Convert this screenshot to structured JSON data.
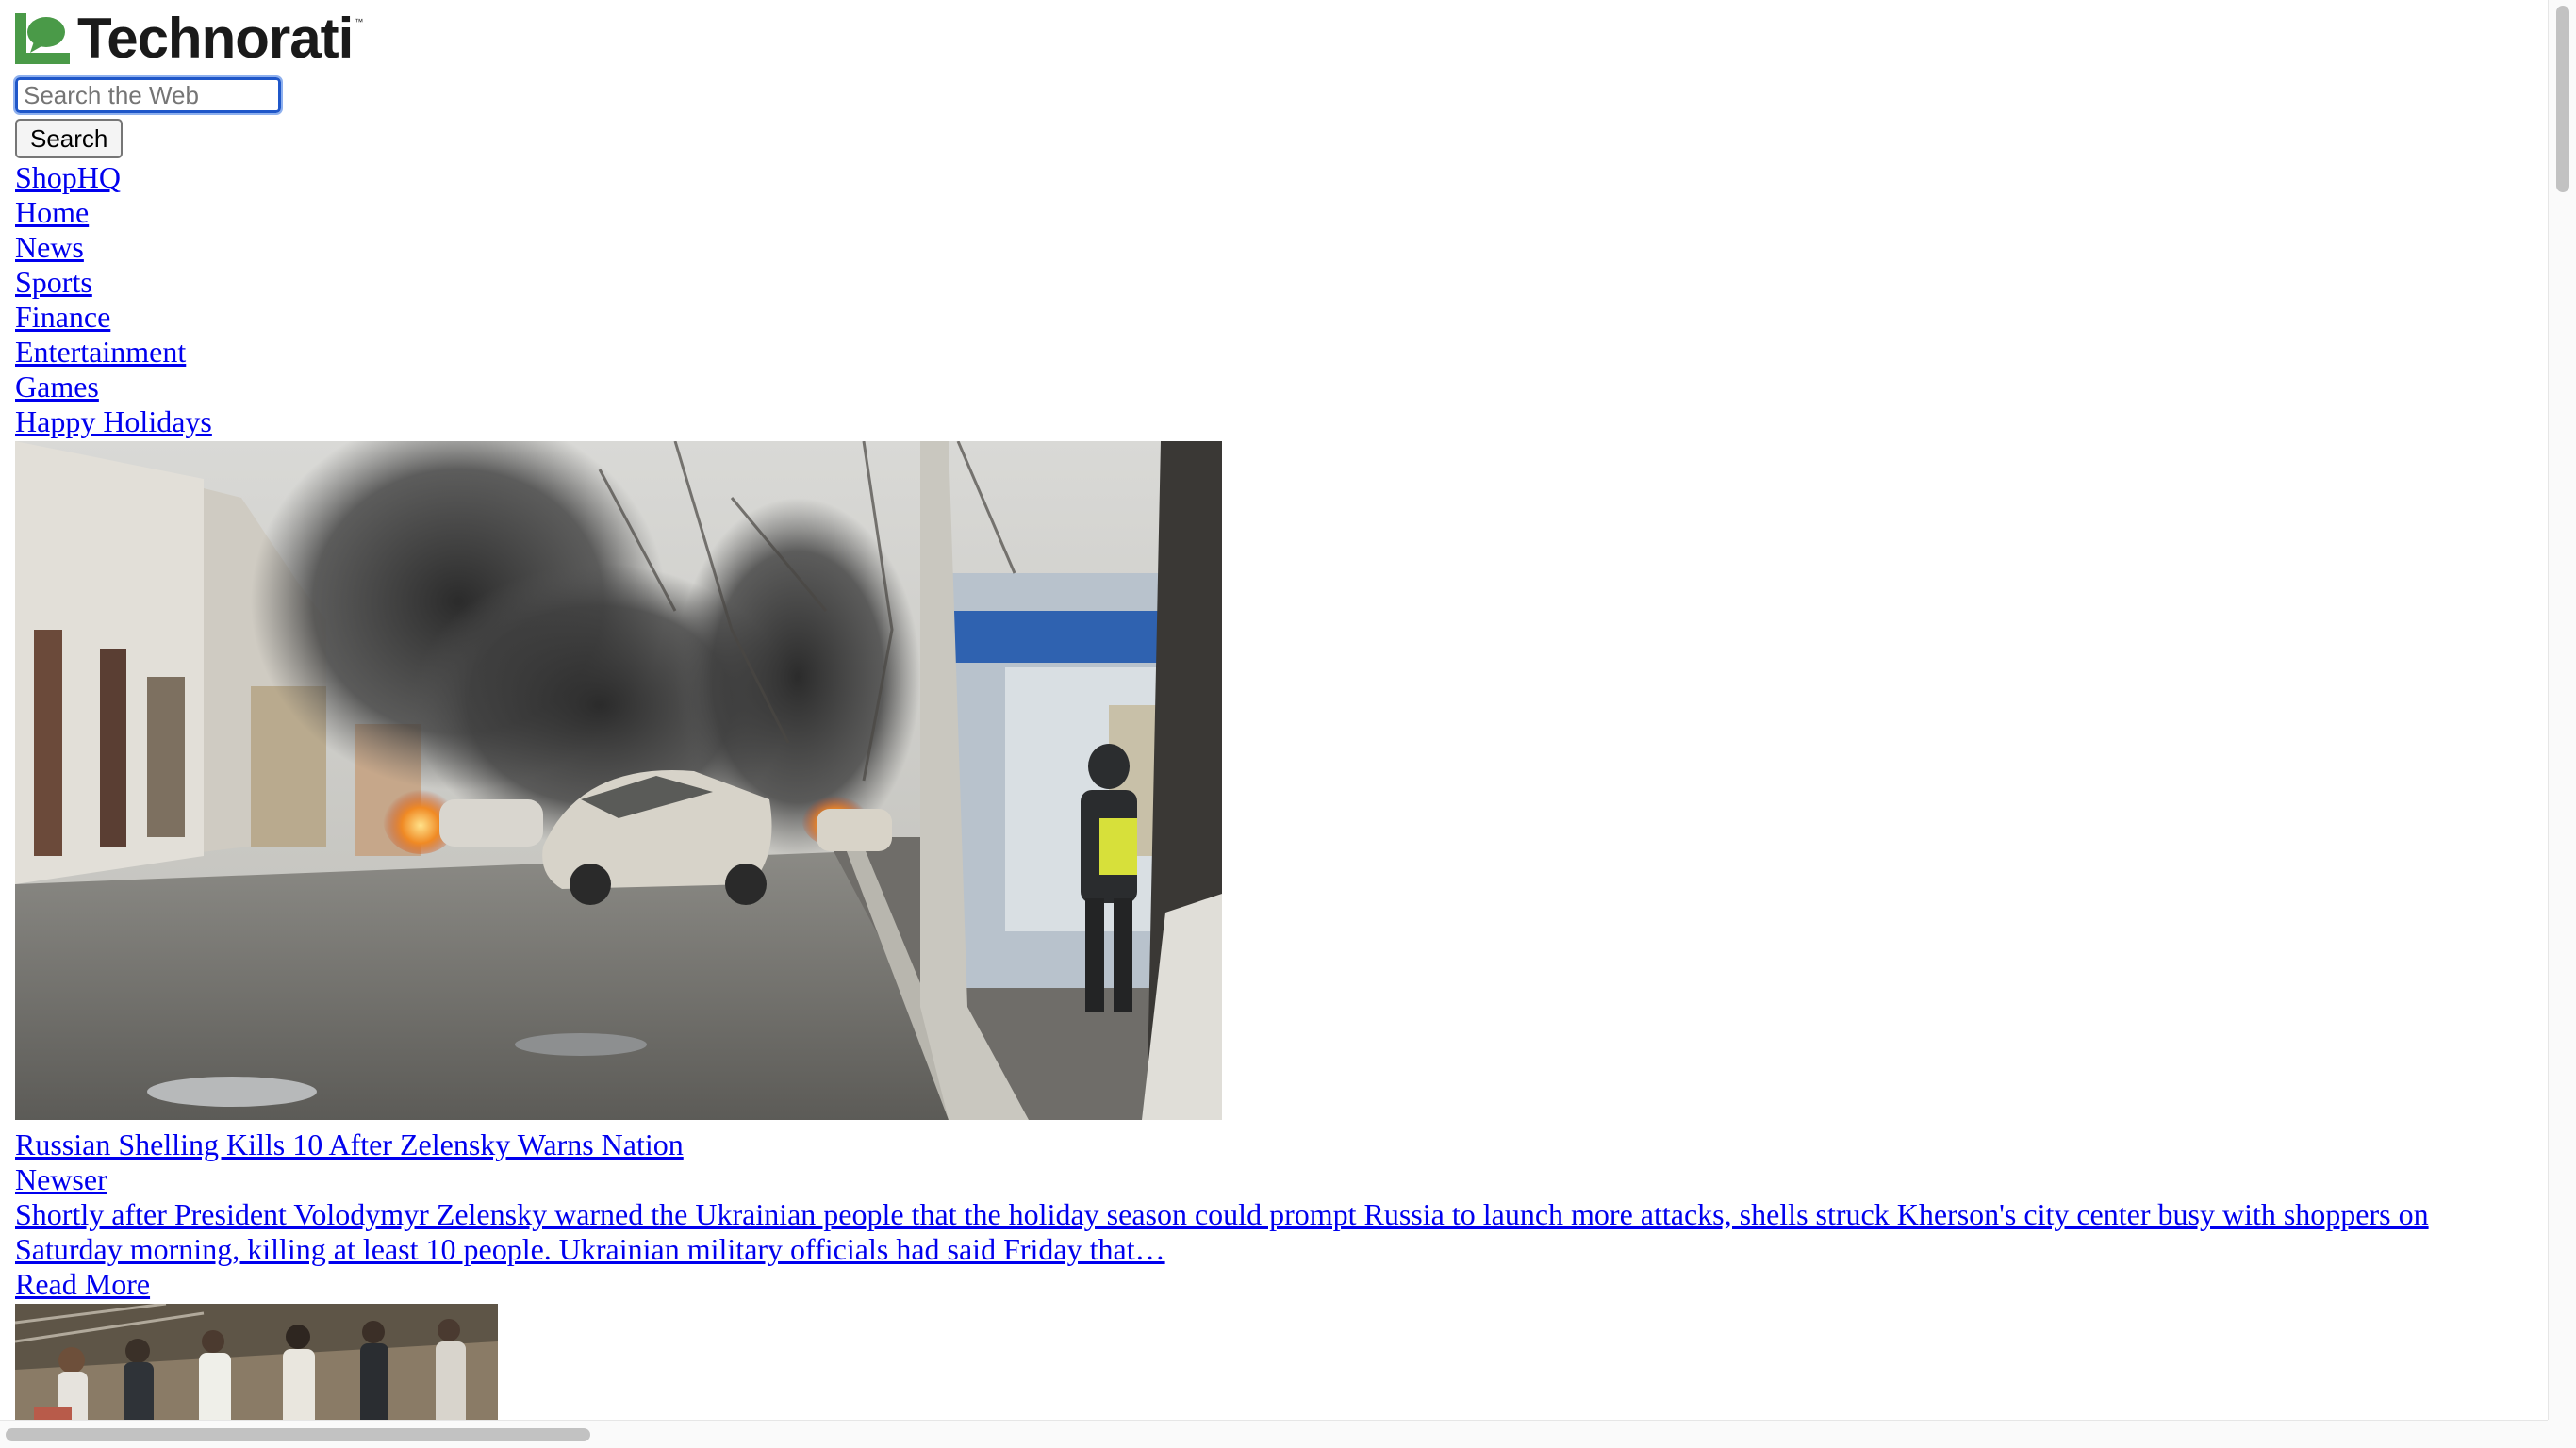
{
  "logo": {
    "text": "Technorati",
    "trademark": "™",
    "mark_color": "#4a9a48"
  },
  "search": {
    "placeholder": "Search the Web",
    "value": "",
    "button_label": "Search",
    "focus_color": "#1f57c9"
  },
  "nav": {
    "links": [
      {
        "label": "ShopHQ"
      },
      {
        "label": "Home"
      },
      {
        "label": "News"
      },
      {
        "label": "Sports"
      },
      {
        "label": "Finance"
      },
      {
        "label": "Entertainment"
      },
      {
        "label": "Games"
      },
      {
        "label": "Happy Holidays"
      }
    ]
  },
  "stories": [
    {
      "image": "street-smoke-burning-cars-photo",
      "headline": "Russian Shelling Kills 10 After Zelensky Warns Nation",
      "source": "Newser",
      "summary": "Shortly after President Volodymyr Zelensky warned the Ukrainian people that the holiday season could prompt Russia to launch more attacks, shells struck Kherson's city center busy with shoppers on Saturday morning, killing at least 10 people. Ukrainian military officials had said Friday that…",
      "read_more": "Read More"
    },
    {
      "image": "crowd-running-thumbnail-photo"
    }
  ],
  "colors": {
    "link": "#0000ee",
    "background": "#ffffff"
  }
}
